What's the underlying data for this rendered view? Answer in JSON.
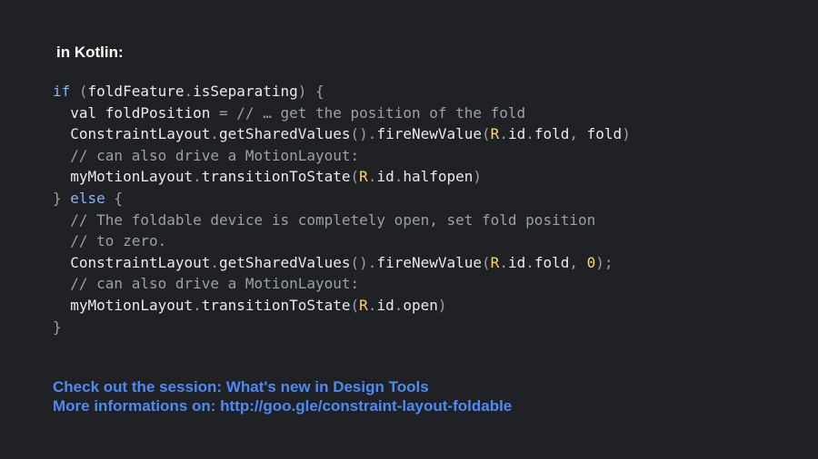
{
  "heading": "in Kotlin:",
  "code_lines": [
    [
      {
        "t": "if",
        "k": "kw"
      },
      {
        "t": " (",
        "k": "punc"
      },
      {
        "t": "foldFeature",
        "k": "plain"
      },
      {
        "t": ".",
        "k": "punc"
      },
      {
        "t": "isSeparating",
        "k": "plain"
      },
      {
        "t": ") {",
        "k": "punc"
      }
    ],
    [
      {
        "t": "  val foldPosition ",
        "k": "plain"
      },
      {
        "t": "= ",
        "k": "punc"
      },
      {
        "t": "// … get the position of the fold",
        "k": "cmt"
      }
    ],
    [
      {
        "t": "  ConstraintLayout",
        "k": "plain"
      },
      {
        "t": ".",
        "k": "punc"
      },
      {
        "t": "getSharedValues",
        "k": "plain"
      },
      {
        "t": "().",
        "k": "punc"
      },
      {
        "t": "fireNewValue",
        "k": "plain"
      },
      {
        "t": "(",
        "k": "punc"
      },
      {
        "t": "R",
        "k": "r"
      },
      {
        "t": ".",
        "k": "punc"
      },
      {
        "t": "id",
        "k": "plain"
      },
      {
        "t": ".",
        "k": "punc"
      },
      {
        "t": "fold",
        "k": "plain"
      },
      {
        "t": ", ",
        "k": "punc"
      },
      {
        "t": "fold",
        "k": "plain"
      },
      {
        "t": ")",
        "k": "punc"
      }
    ],
    [
      {
        "t": "  // can also drive a MotionLayout:",
        "k": "cmt"
      }
    ],
    [
      {
        "t": "  myMotionLayout",
        "k": "plain"
      },
      {
        "t": ".",
        "k": "punc"
      },
      {
        "t": "transitionToState",
        "k": "plain"
      },
      {
        "t": "(",
        "k": "punc"
      },
      {
        "t": "R",
        "k": "r"
      },
      {
        "t": ".",
        "k": "punc"
      },
      {
        "t": "id",
        "k": "plain"
      },
      {
        "t": ".",
        "k": "punc"
      },
      {
        "t": "halfopen",
        "k": "plain"
      },
      {
        "t": ")",
        "k": "punc"
      }
    ],
    [
      {
        "t": "} ",
        "k": "punc"
      },
      {
        "t": "else",
        "k": "kw"
      },
      {
        "t": " {",
        "k": "punc"
      }
    ],
    [
      {
        "t": "  // The foldable device is completely open, set fold position",
        "k": "cmt"
      }
    ],
    [
      {
        "t": "  // to zero.",
        "k": "cmt"
      }
    ],
    [
      {
        "t": "  ConstraintLayout",
        "k": "plain"
      },
      {
        "t": ".",
        "k": "punc"
      },
      {
        "t": "getSharedValues",
        "k": "plain"
      },
      {
        "t": "().",
        "k": "punc"
      },
      {
        "t": "fireNewValue",
        "k": "plain"
      },
      {
        "t": "(",
        "k": "punc"
      },
      {
        "t": "R",
        "k": "r"
      },
      {
        "t": ".",
        "k": "punc"
      },
      {
        "t": "id",
        "k": "plain"
      },
      {
        "t": ".",
        "k": "punc"
      },
      {
        "t": "fold",
        "k": "plain"
      },
      {
        "t": ", ",
        "k": "punc"
      },
      {
        "t": "0",
        "k": "num"
      },
      {
        "t": ");",
        "k": "punc"
      }
    ],
    [
      {
        "t": "  // can also drive a MotionLayout:",
        "k": "cmt"
      }
    ],
    [
      {
        "t": "  myMotionLayout",
        "k": "plain"
      },
      {
        "t": ".",
        "k": "punc"
      },
      {
        "t": "transitionToState",
        "k": "plain"
      },
      {
        "t": "(",
        "k": "punc"
      },
      {
        "t": "R",
        "k": "r"
      },
      {
        "t": ".",
        "k": "punc"
      },
      {
        "t": "id",
        "k": "plain"
      },
      {
        "t": ".",
        "k": "punc"
      },
      {
        "t": "open",
        "k": "plain"
      },
      {
        "t": ")",
        "k": "punc"
      }
    ],
    [
      {
        "t": "}",
        "k": "punc"
      }
    ]
  ],
  "links": [
    "Check out the session: What's new in Design Tools",
    "More informations on: http://goo.gle/constraint-layout-foldable"
  ],
  "colors": {
    "background": "#202124",
    "keyword": "#8ab4f8",
    "identifier": "#e8eaed",
    "comment": "#9aa0a6",
    "literal": "#fdd663",
    "link": "#4c8bf5"
  }
}
